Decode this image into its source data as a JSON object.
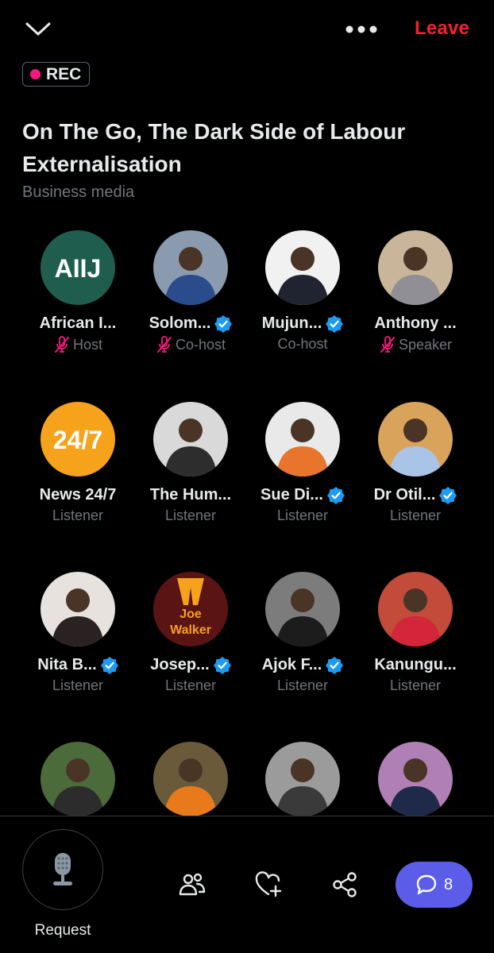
{
  "topbar": {
    "leave_label": "Leave"
  },
  "rec": {
    "label": "REC"
  },
  "space": {
    "title": "On The Go, The Dark Side of Labour Externalisation",
    "subtitle": "Business media"
  },
  "people": [
    {
      "name": "African I...",
      "role": "Host",
      "muted": true,
      "verified": false,
      "avatar_text": "AIIJ",
      "avatar_bg": "#1f5e4f"
    },
    {
      "name": "Solom...",
      "role": "Co-host",
      "muted": true,
      "verified": true,
      "avatar_bg": "#8a9bb0",
      "suit": "#2b4c8c"
    },
    {
      "name": "Mujun...",
      "role": "Co-host",
      "muted": false,
      "verified": true,
      "avatar_bg": "#f1f1f1",
      "suit": "#1f2430"
    },
    {
      "name": "Anthony ...",
      "role": "Speaker",
      "muted": true,
      "verified": false,
      "avatar_bg": "#c9b59a",
      "suit": "#8f8f95"
    },
    {
      "name": "News 24/7",
      "role": "Listener",
      "muted": false,
      "verified": false,
      "avatar_text": "24/7",
      "avatar_bg": "#f7a21b"
    },
    {
      "name": "The Hum...",
      "role": "Listener",
      "muted": false,
      "verified": false,
      "avatar_bg": "#d9d9d9",
      "suit": "#2d2d2d"
    },
    {
      "name": "Sue Di...",
      "role": "Listener",
      "muted": false,
      "verified": true,
      "avatar_bg": "#e9e9e9",
      "suit": "#e9742c"
    },
    {
      "name": "Dr Otil...",
      "role": "Listener",
      "muted": false,
      "verified": true,
      "avatar_bg": "#d9a35b",
      "suit": "#a9c4e6"
    },
    {
      "name": "Nita B...",
      "role": "Listener",
      "muted": false,
      "verified": true,
      "avatar_bg": "#e7e2de",
      "suit": "#2a2222"
    },
    {
      "name": "Josep...",
      "role": "Listener",
      "muted": false,
      "verified": true,
      "avatar_text": "Joe\nWalker",
      "avatar_bg": "#5a1414"
    },
    {
      "name": "Ajok F...",
      "role": "Listener",
      "muted": false,
      "verified": true,
      "avatar_bg": "#7c7c7c",
      "suit": "#1c1c1c"
    },
    {
      "name": "Kanungu...",
      "role": "Listener",
      "muted": false,
      "verified": false,
      "avatar_bg": "#c24b3a",
      "suit": "#d4263a"
    },
    {
      "name": "",
      "role": "",
      "muted": false,
      "verified": false,
      "avatar_bg": "#4c6b3a",
      "suit": "#2c2c2c"
    },
    {
      "name": "",
      "role": "",
      "muted": false,
      "verified": false,
      "avatar_bg": "#6b5a3a",
      "suit": "#e87a1c"
    },
    {
      "name": "",
      "role": "",
      "muted": false,
      "verified": false,
      "avatar_bg": "#9b9b9b",
      "suit": "#3a3a3a"
    },
    {
      "name": "",
      "role": "",
      "muted": false,
      "verified": false,
      "avatar_bg": "#b07fb5",
      "suit": "#1f2a4a"
    }
  ],
  "bottom": {
    "request_label": "Request",
    "reply_count": "8"
  },
  "colors": {
    "accent_blue": "#1d9bf0",
    "leave_red": "#f4212e",
    "rec_pink": "#f91880",
    "muted_pink": "#f91880",
    "reply_purple": "#5b5de8"
  },
  "icons": [
    "chevron-down-icon",
    "more-icon",
    "microphone-icon",
    "people-icon",
    "heart-plus-icon",
    "share-icon",
    "chat-bubble-icon",
    "verified-badge-icon",
    "mic-off-icon"
  ]
}
